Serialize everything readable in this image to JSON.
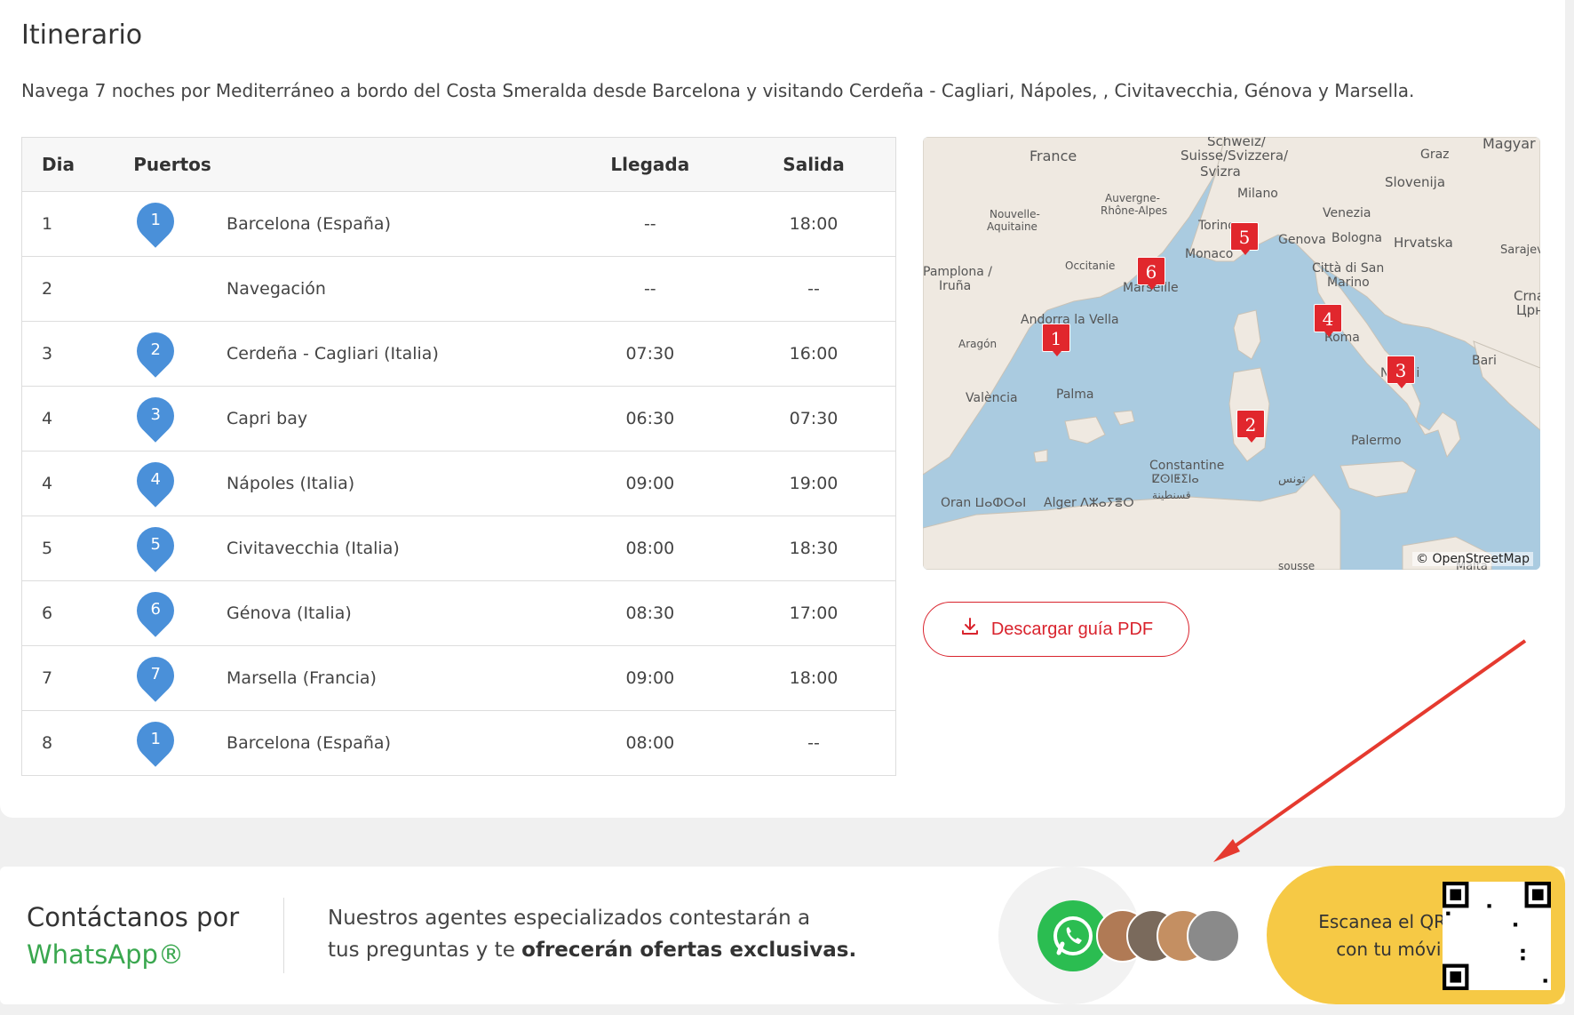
{
  "section": {
    "title": "Itinerario",
    "intro": "Navega 7 noches por Mediterráneo a bordo del Costa Smeralda desde Barcelona y visitando Cerdeña - Cagliari, Nápoles, , Civitavecchia, Génova y Marsella."
  },
  "table": {
    "headers": {
      "dia": "Dia",
      "puertos": "Puertos",
      "llegada": "Llegada",
      "salida": "Salida"
    },
    "rows": [
      {
        "dia": "1",
        "pin": "1",
        "port": "Barcelona (España)",
        "arrive": "--",
        "depart": "18:00"
      },
      {
        "dia": "2",
        "pin": "",
        "port": "Navegación",
        "arrive": "--",
        "depart": "--"
      },
      {
        "dia": "3",
        "pin": "2",
        "port": "Cerdeña - Cagliari (Italia)",
        "arrive": "07:30",
        "depart": "16:00"
      },
      {
        "dia": "4",
        "pin": "3",
        "port": "Capri bay",
        "arrive": "06:30",
        "depart": "07:30"
      },
      {
        "dia": "4",
        "pin": "4",
        "port": "Nápoles (Italia)",
        "arrive": "09:00",
        "depart": "19:00"
      },
      {
        "dia": "5",
        "pin": "5",
        "port": "Civitavecchia (Italia)",
        "arrive": "08:00",
        "depart": "18:30"
      },
      {
        "dia": "6",
        "pin": "6",
        "port": "Génova (Italia)",
        "arrive": "08:30",
        "depart": "17:00"
      },
      {
        "dia": "7",
        "pin": "7",
        "port": "Marsella (Francia)",
        "arrive": "09:00",
        "depart": "18:00"
      },
      {
        "dia": "8",
        "pin": "1",
        "port": "Barcelona (España)",
        "arrive": "08:00",
        "depart": "--"
      }
    ]
  },
  "map": {
    "labels": [
      "France",
      "Schweiz/",
      "Suisse/Svizzera/",
      "Svizra",
      "Magyar",
      "Graz",
      "Slovenija",
      "Auvergne-",
      "Rhône-Alpes",
      "Nouvelle-",
      "Aquitaine",
      "Milano",
      "Venezia",
      "Torino",
      "Genova",
      "Bologna",
      "Hrvatska",
      "Sarajevo",
      "Occitanie",
      "Monaco",
      "Pamplona /",
      "Iruña",
      "Marseille",
      "Città di San",
      "Marino",
      "Crna G",
      "Црна",
      "Andorra la Vella",
      "Aragón",
      "Roma",
      "Napoli",
      "Bari",
      "València",
      "Palma",
      "Palermo",
      "Constantine",
      "ⵇⵙⵏⵟⵉⵏⴰ",
      "قسنطينة",
      "Oran ⵡⴰⵀⵔⴰⵏ",
      "Alger ⴷⵣⴰⵢⴻⵔ",
      "تونس",
      "Malta",
      "sousse"
    ],
    "markers": [
      "1",
      "2",
      "3",
      "4",
      "5",
      "6"
    ],
    "attribution": "© OpenStreetMap"
  },
  "pdf_button": {
    "label": "Descargar guía PDF"
  },
  "whatsapp": {
    "title_prefix": "Contáctanos por",
    "title_brand": "WhatsApp®",
    "desc_line1": "Nuestros agentes especializados contestarán a",
    "desc_line2_a": "tus preguntas y te ",
    "desc_line2_b": "ofrecerán ofertas exclusivas.",
    "qr_line1": "Escanea el QR",
    "qr_line2": "con tu móvil",
    "brand_color": "#3aa74f",
    "qr_bg": "#f6c945"
  },
  "colors": {
    "accent_red": "#d9232d",
    "pin_blue": "#4a90d9"
  }
}
